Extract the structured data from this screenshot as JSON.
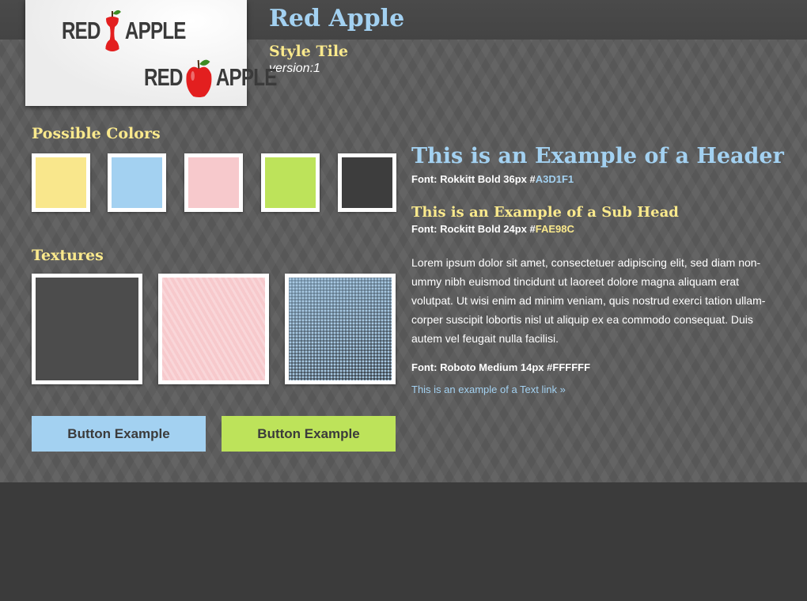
{
  "logo": {
    "word_left": "RED",
    "word_right": "APPLE"
  },
  "title": {
    "main": "Red Apple",
    "sub": "Style Tile",
    "version": "version:1"
  },
  "sections": {
    "colors": "Possible Colors",
    "textures": "Textures"
  },
  "swatches": [
    "#F9E78C",
    "#A3D1F1",
    "#F7C9CC",
    "#BDE35A",
    "#3D3D3D"
  ],
  "buttons": [
    {
      "label": "Button Example",
      "color": "#A3D1F1"
    },
    {
      "label": "Button Example",
      "color": "#BDE35A"
    }
  ],
  "examples": {
    "header": "This is an Example of a Header",
    "header_font": "Font: Rokkitt Bold 36px #",
    "header_color": "A3D1F1",
    "subhead": "This is an Example of a Sub Head",
    "subhead_font": "Font: Rockitt Bold 24px #",
    "subhead_color": "FAE98C",
    "body": "Lorem ipsum dolor sit amet, consectetuer adipiscing elit, sed diam non-ummy nibh euismod tincidunt ut laoreet dolore magna aliquam erat volutpat. Ut wisi enim ad minim veniam, quis nostrud exerci tation ullam-corper suscipit lobortis nisl ut aliquip ex ea commodo consequat. Duis autem vel feugait nulla facilisi.",
    "body_font": "Font: Roboto Medium 14px #FFFFFF",
    "link": "This is an example of a Text link »"
  },
  "colors": {
    "header_blue": "#A3D1F1",
    "subhead_yellow": "#FAE98C",
    "apple_red": "#E31F1F"
  }
}
